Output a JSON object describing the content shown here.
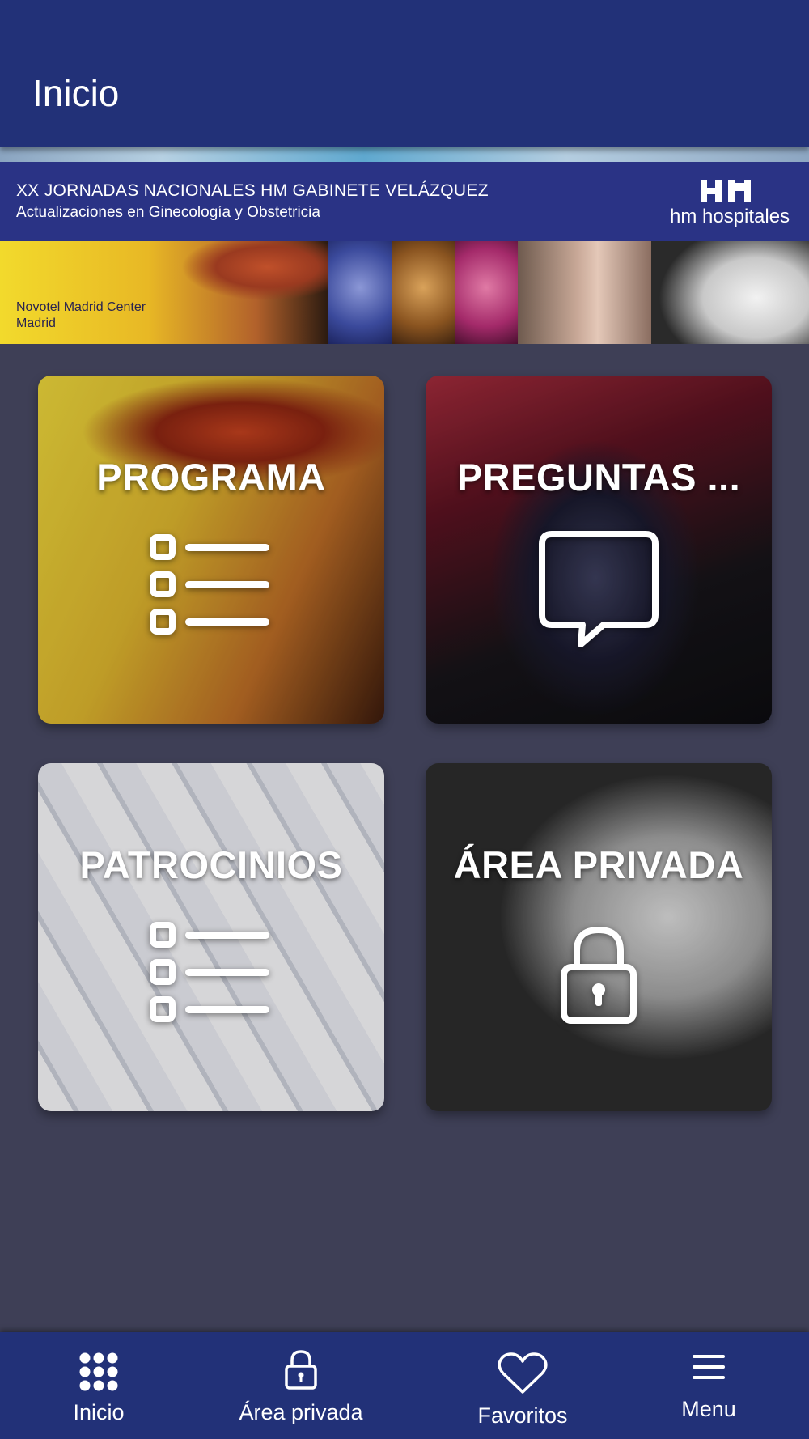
{
  "header": {
    "title": "Inicio"
  },
  "banner": {
    "title": "XX JORNADAS NACIONALES HM GABINETE VELÁZQUEZ",
    "subtitle": "Actualizaciones en Ginecología y Obstetricia",
    "venue_line1": "Novotel Madrid Center",
    "venue_line2": "Madrid",
    "logo_text": "hm hospitales",
    "logo_icon": "hm-logo-icon"
  },
  "tiles": [
    {
      "label": "PROGRAMA",
      "icon": "list-icon"
    },
    {
      "label": "PREGUNTAS ...",
      "icon": "chat-bubble-icon"
    },
    {
      "label": "PATROCINIOS",
      "icon": "list-icon"
    },
    {
      "label": "ÁREA PRIVADA",
      "icon": "lock-icon"
    }
  ],
  "tabbar": {
    "items": [
      {
        "label": "Inicio",
        "icon": "grid-icon"
      },
      {
        "label": "Área privada",
        "icon": "lock-icon"
      },
      {
        "label": "Favoritos",
        "icon": "heart-icon"
      },
      {
        "label": "Menu",
        "icon": "hamburger-icon"
      }
    ]
  },
  "colors": {
    "header_bg": "#223178",
    "content_bg": "#3e3f56",
    "banner_bg": "#2a3385",
    "text": "#ffffff"
  }
}
